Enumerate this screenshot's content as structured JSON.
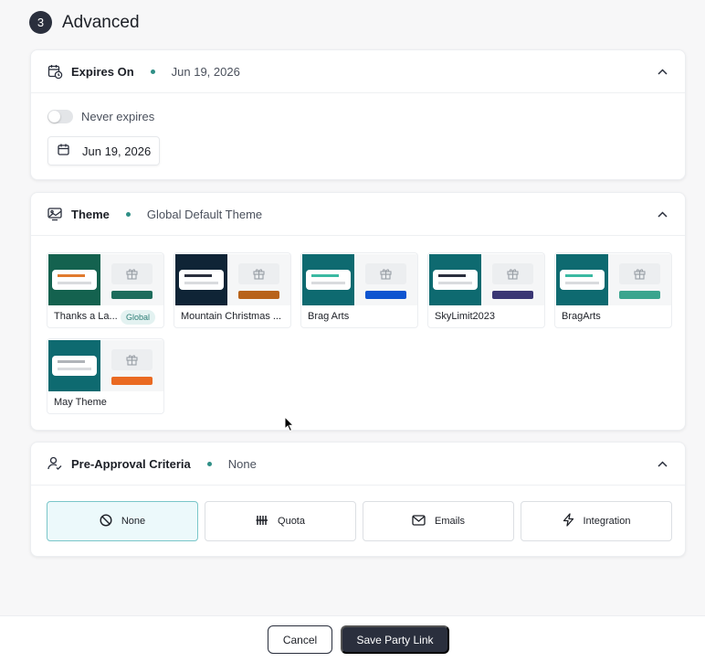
{
  "section": {
    "step": "3",
    "title": "Advanced"
  },
  "expires": {
    "title": "Expires On",
    "value": "Jun 19, 2026",
    "toggle_label": "Never expires",
    "toggle_on": false,
    "date_value": "Jun 19, 2026"
  },
  "theme": {
    "title": "Theme",
    "value": "Global Default Theme",
    "items": [
      {
        "name": "Thanks a La...",
        "badge": "Global",
        "bg": "#14624f",
        "bar": "#1d6c5c",
        "mini": "#e07a2e"
      },
      {
        "name": "Mountain Christmas ...",
        "badge": "",
        "bg": "#0f2436",
        "bar": "#b8621a",
        "mini": "#2a2f3d"
      },
      {
        "name": "Brag Arts",
        "badge": "",
        "bg": "#0e6a70",
        "bar": "#0d54d0",
        "mini": "#3ab9a2"
      },
      {
        "name": "SkyLimit2023",
        "badge": "",
        "bg": "#0e6a70",
        "bar": "#3a3674",
        "mini": "#2a2f3d"
      },
      {
        "name": "BragArts",
        "badge": "",
        "bg": "#0e6a70",
        "bar": "#3aa58e",
        "mini": "#3ab9a2"
      },
      {
        "name": "May Theme",
        "badge": "",
        "bg": "#0e6a70",
        "bar": "#ea6a22",
        "mini": "#b0b4b9"
      }
    ]
  },
  "criteria": {
    "title": "Pre-Approval Criteria",
    "value": "None",
    "options": [
      {
        "label": "None",
        "icon": "ban-icon",
        "selected": true
      },
      {
        "label": "Quota",
        "icon": "quota-icon",
        "selected": false
      },
      {
        "label": "Emails",
        "icon": "mail-icon",
        "selected": false
      },
      {
        "label": "Integration",
        "icon": "lightning-icon",
        "selected": false
      }
    ]
  },
  "footer": {
    "cancel_label": "Cancel",
    "save_label": "Save Party Link"
  },
  "colors": {
    "primary": "#2a2f3d",
    "accent": "#2f8f86",
    "selected_bg": "#ecf9fb"
  }
}
